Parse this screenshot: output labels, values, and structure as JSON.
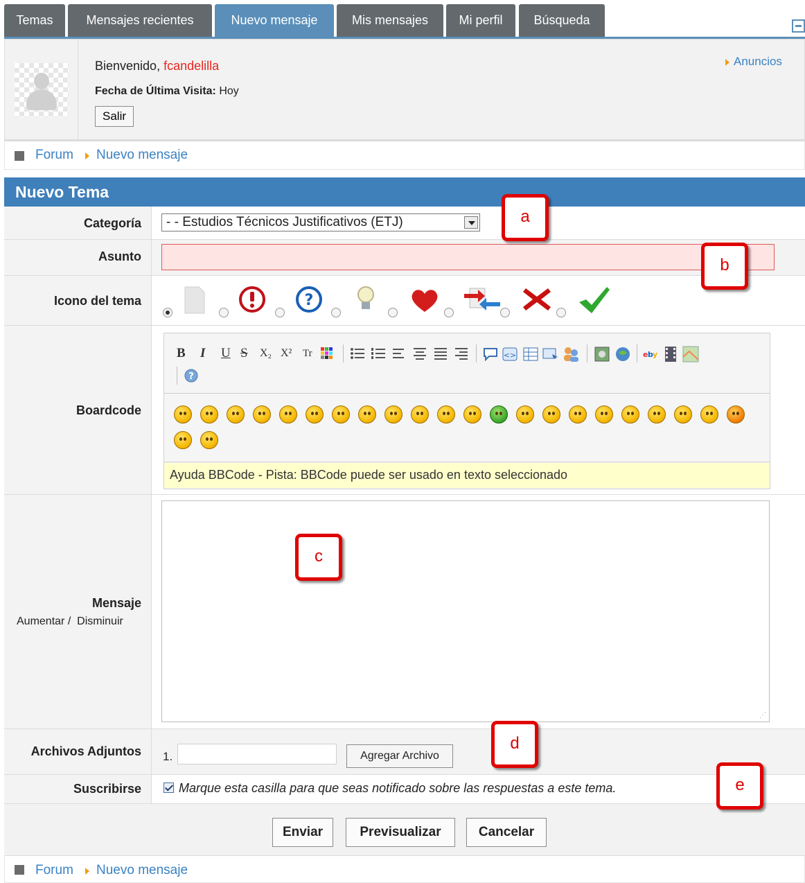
{
  "tabs": [
    {
      "label": "Temas",
      "active": false
    },
    {
      "label": "Mensajes recientes",
      "active": false
    },
    {
      "label": "Nuevo mensaje",
      "active": true
    },
    {
      "label": "Mis mensajes",
      "active": false
    },
    {
      "label": "Mi perfil",
      "active": false
    },
    {
      "label": "Búsqueda",
      "active": false
    }
  ],
  "user_panel": {
    "welcome_prefix": "Bienvenido, ",
    "username": "fcandelilla",
    "last_visit_label": "Fecha de Última Visita:",
    "last_visit_value": "Hoy",
    "logout_label": "Salir",
    "announcements_label": "Anuncios"
  },
  "breadcrumb": {
    "root": "Forum",
    "current": "Nuevo mensaje"
  },
  "form": {
    "title": "Nuevo Tema",
    "category_label": "Categoría",
    "category_value": "- - Estudios Técnicos Justificativos (ETJ)",
    "subject_label": "Asunto",
    "subject_value": "",
    "topic_icon_label": "Icono del tema",
    "topic_icons": [
      "blank-page-icon",
      "exclamation-icon",
      "question-icon",
      "lightbulb-icon",
      "heart-icon",
      "transfer-arrows-icon",
      "red-x-icon",
      "checkmark-icon"
    ],
    "topic_icon_selected": 0,
    "boardcode_label": "Boardcode",
    "bbcode_help": "Ayuda BBCode - Pista: BBCode puede ser usado en texto seleccionado",
    "message_label": "Mensaje",
    "grow_label": "Aumentar",
    "shrink_label": "Disminuir",
    "attachments_label": "Archivos Adjuntos",
    "attachment_index": "1.",
    "add_file_label": "Agregar Archivo",
    "subscribe_label": "Suscribirse",
    "subscribe_text": "Marque esta casilla para que seas notificado sobre las respuestas a este tema.",
    "subscribe_checked": true
  },
  "toolbar": {
    "bold": "B",
    "italic": "I",
    "underline": "U",
    "strike": "S",
    "subscript": "X₂",
    "superscript": "X²",
    "font_size": "Tr"
  },
  "actions": {
    "submit": "Enviar",
    "preview": "Previsualizar",
    "cancel": "Cancelar"
  },
  "markers": [
    "a",
    "b",
    "c",
    "d",
    "e"
  ],
  "colors": {
    "tab_bg": "#63696d",
    "tab_active": "#5b8fb9",
    "header_blue": "#3f7fba",
    "link": "#3a82c4",
    "username": "#e8251f",
    "marker_red": "#e00000"
  }
}
